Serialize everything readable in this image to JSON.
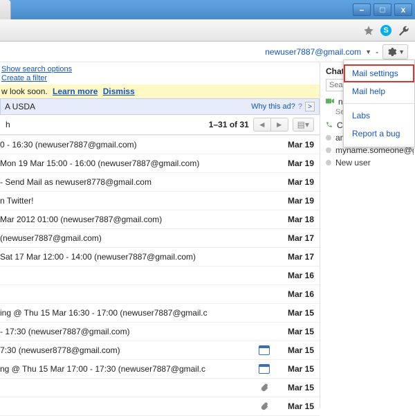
{
  "account": {
    "email": "newuser7887@gmail.com"
  },
  "search_links": {
    "show_options": "Show search options",
    "create_filter": "Create a filter"
  },
  "new_look": {
    "text": "w look soon.",
    "learn": "Learn more",
    "dismiss": "Dismiss"
  },
  "ad": {
    "text": "A USDA",
    "why": "Why this ad?"
  },
  "list": {
    "counter": "1–31 of 31",
    "left_btn_label": "h"
  },
  "mails": [
    {
      "subj": "0 - 16:30 (newuser7887@gmail.com)",
      "date": "Mar 19",
      "icon": ""
    },
    {
      "subj": "Mon 19 Mar 15:00 - 16:00 (newuser7887@gmail.com)",
      "date": "Mar 19",
      "icon": ""
    },
    {
      "subj": "- Send Mail as newuser8778@gmail.com",
      "date": "Mar 19",
      "icon": ""
    },
    {
      "subj": "n Twitter!",
      "date": "Mar 19",
      "icon": ""
    },
    {
      "subj": "Mar 2012 01:00 (newuser7887@gmail.com)",
      "date": "Mar 18",
      "icon": ""
    },
    {
      "subj": "(newuser7887@gmail.com)",
      "date": "Mar 17",
      "icon": ""
    },
    {
      "subj": "Sat 17 Mar 12:00 - 14:00 (newuser7887@gmail.com)",
      "date": "Mar 17",
      "icon": ""
    },
    {
      "subj": "",
      "date": "Mar 16",
      "icon": ""
    },
    {
      "subj": "",
      "date": "Mar 16",
      "icon": ""
    },
    {
      "subj": "ing @ Thu 15 Mar 16:30 - 17:00 (newuser7887@gmail.c",
      "date": "Mar 15",
      "icon": ""
    },
    {
      "subj": "- 17:30 (newuser7887@gmail.com)",
      "date": "Mar 15",
      "icon": ""
    },
    {
      "subj": "7:30 (newuser8778@gmail.com)",
      "date": "Mar 15",
      "icon": "cal"
    },
    {
      "subj": "ng @ Thu 15 Mar 17:00 - 17:30 (newuser7887@gmail.c",
      "date": "Mar 15",
      "icon": "cal"
    },
    {
      "subj": "",
      "date": "Mar 15",
      "icon": "clip"
    },
    {
      "subj": "",
      "date": "Mar 15",
      "icon": "clip"
    }
  ],
  "chat": {
    "title": "Chat a",
    "search_placeholder": "Searc",
    "me": "new",
    "status": "Set status here",
    "call_phone": "Call phone",
    "contacts": [
      "another user",
      "myname.someone@g...",
      "New user"
    ]
  },
  "menu": {
    "mail_settings": "Mail settings",
    "mail_help": "Mail help",
    "labs": "Labs",
    "report_bug": "Report a bug"
  }
}
